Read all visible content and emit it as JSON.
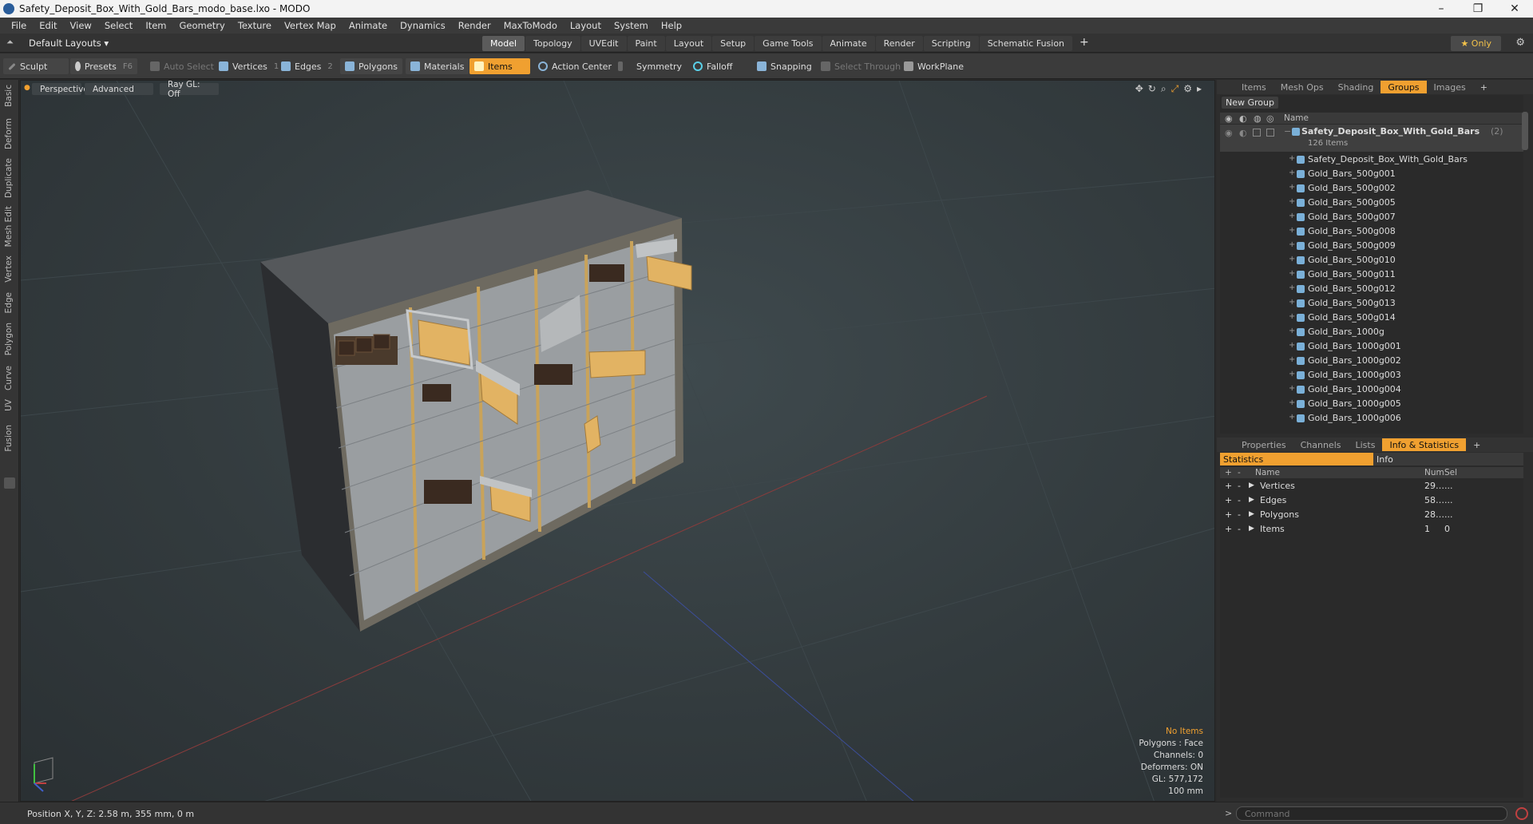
{
  "window": {
    "title": "Safety_Deposit_Box_With_Gold_Bars_modo_base.lxo - MODO",
    "controls": [
      "–",
      "❐",
      "✕"
    ]
  },
  "menu": [
    "File",
    "Edit",
    "View",
    "Select",
    "Item",
    "Geometry",
    "Texture",
    "Vertex Map",
    "Animate",
    "Dynamics",
    "Render",
    "MaxToModo",
    "Layout",
    "System",
    "Help"
  ],
  "layout": {
    "dropdown": "Default Layouts ▾",
    "tabs": [
      "Model",
      "Topology",
      "UVEdit",
      "Paint",
      "Layout",
      "Setup",
      "Game Tools",
      "Animate",
      "Render",
      "Scripting",
      "Schematic Fusion"
    ],
    "active_tab": "Model",
    "only": "★ Only"
  },
  "toolbar": {
    "sculpt": "Sculpt",
    "presets": "Presets",
    "presets_key": "F6",
    "auto_select": "Auto Select",
    "vertices": "Vertices",
    "vertices_key": "1",
    "edges": "Edges",
    "edges_key": "2",
    "polygons": "Polygons",
    "materials": "Materials",
    "items": "Items",
    "action_center": "Action Center",
    "symmetry": "Symmetry",
    "falloff": "Falloff",
    "snapping": "Snapping",
    "select_through": "Select Through",
    "workplane": "WorkPlane"
  },
  "left_tabs": [
    "Basic",
    "Deform",
    "Duplicate",
    "Mesh Edit",
    "Vertex",
    "Edge",
    "Polygon",
    "Curve",
    "UV",
    "Fusion"
  ],
  "viewport": {
    "perspective": "Perspective",
    "advanced": "Advanced",
    "raygl": "Ray GL: Off",
    "hud": {
      "items": "No Items",
      "polygons": "Polygons : Face",
      "channels": "Channels: 0",
      "deformers": "Deformers: ON",
      "gl": "GL: 577,172",
      "scale": "100 mm"
    }
  },
  "status": {
    "position": "Position X, Y, Z:   2.58 m, 355 mm, 0 m"
  },
  "command": {
    "placeholder": "Command",
    "prompt": ">"
  },
  "groups_panel": {
    "tabs": [
      "Items",
      "Mesh Ops",
      "Shading",
      "Groups",
      "Images"
    ],
    "active": "Groups",
    "new_group": "New Group",
    "col_name": "Name",
    "root": {
      "name": "Safety_Deposit_Box_With_Gold_Bars",
      "count": "(2)",
      "sub": "126 Items"
    },
    "items": [
      "Safety_Deposit_Box_With_Gold_Bars",
      "Gold_Bars_500g001",
      "Gold_Bars_500g002",
      "Gold_Bars_500g005",
      "Gold_Bars_500g007",
      "Gold_Bars_500g008",
      "Gold_Bars_500g009",
      "Gold_Bars_500g010",
      "Gold_Bars_500g011",
      "Gold_Bars_500g012",
      "Gold_Bars_500g013",
      "Gold_Bars_500g014",
      "Gold_Bars_1000g",
      "Gold_Bars_1000g001",
      "Gold_Bars_1000g002",
      "Gold_Bars_1000g003",
      "Gold_Bars_1000g004",
      "Gold_Bars_1000g005",
      "Gold_Bars_1000g006"
    ]
  },
  "stats_panel": {
    "tabs": [
      "Properties",
      "Channels",
      "Lists",
      "Info & Statistics"
    ],
    "active": "Info & Statistics",
    "subtabs": [
      "Statistics",
      "Info"
    ],
    "headers": {
      "name": "Name",
      "num": "Num",
      "sel": "Sel"
    },
    "rows": [
      {
        "name": "Vertices",
        "num": "29…",
        "sel": "..."
      },
      {
        "name": "Edges",
        "num": "58…",
        "sel": "..."
      },
      {
        "name": "Polygons",
        "num": "28…",
        "sel": "..."
      },
      {
        "name": "Items",
        "num": "1",
        "sel": "0"
      }
    ]
  },
  "colors": {
    "accent": "#f0a030",
    "gold": "#e2b363",
    "steel": "#b9bcbe"
  }
}
